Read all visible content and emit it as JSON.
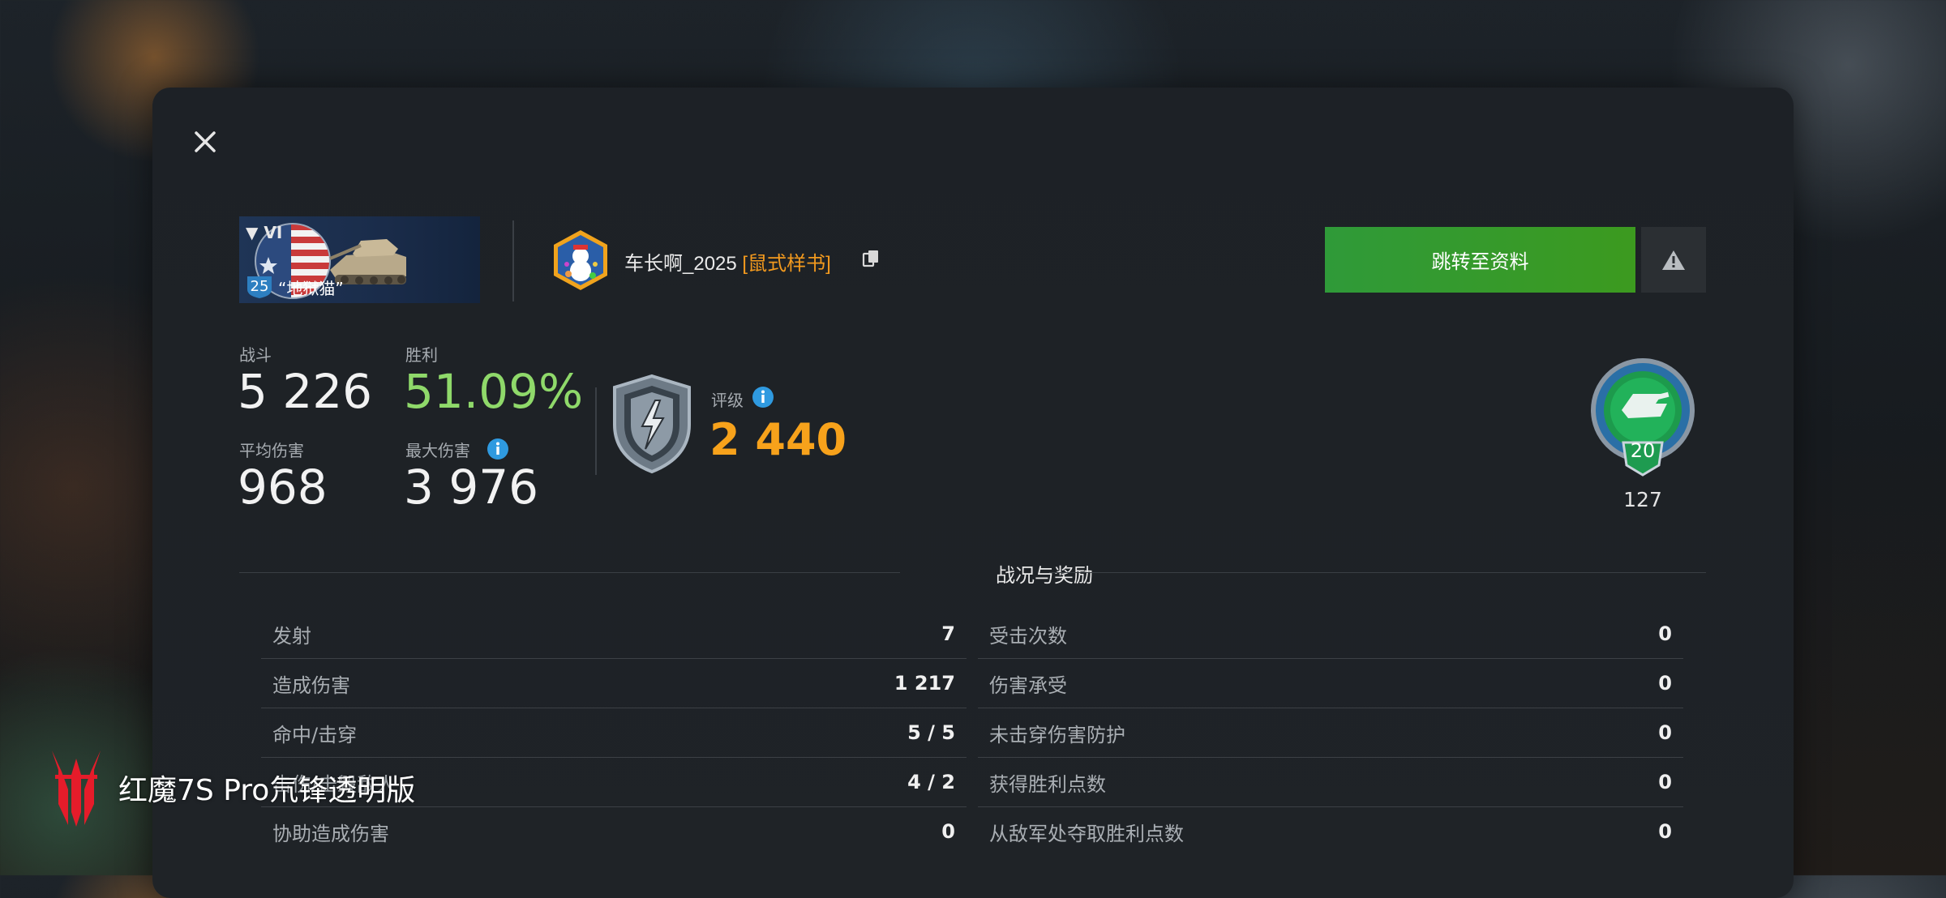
{
  "tank": {
    "tier": "▼ VI",
    "level": "25",
    "name": "“地狱猫”"
  },
  "player": {
    "name": "车长啊_2025",
    "clan": "[鼠式样书]"
  },
  "actions": {
    "profile_label": "跳转至资料"
  },
  "stats": {
    "battles_label": "战斗",
    "battles": "5 226",
    "wins_label": "胜利",
    "wins": "51.09%",
    "avg_damage_label": "平均伤害",
    "avg_damage": "968",
    "max_damage_label": "最大伤害",
    "max_damage": "3 976",
    "rating_label": "评级",
    "rating": "2 440"
  },
  "mastery": {
    "level": "20",
    "count": "127"
  },
  "section": {
    "title": "战况与奖励"
  },
  "battle_table": {
    "left": [
      {
        "label": "发射",
        "value": "7"
      },
      {
        "label": "造成伤害",
        "value": "1 217"
      },
      {
        "label": "命中/击穿",
        "value": "5 / 5"
      },
      {
        "label": "击伤/击毁敌人",
        "value": "4 / 2"
      },
      {
        "label": "协助造成伤害",
        "value": "0"
      }
    ],
    "right": [
      {
        "label": "受击次数",
        "value": "0"
      },
      {
        "label": "伤害承受",
        "value": "0"
      },
      {
        "label": "未击穿伤害防护",
        "value": "0"
      },
      {
        "label": "获得胜利点数",
        "value": "0"
      },
      {
        "label": "从敌军处夺取胜利点数",
        "value": "0"
      }
    ]
  },
  "watermark": {
    "text": "红魔7S Pro氘锋透明版"
  },
  "colors": {
    "accent_orange": "#f7a21b",
    "win_green": "#8fd96a",
    "button_green": "#34992d",
    "info_blue": "#2f9ae0"
  }
}
